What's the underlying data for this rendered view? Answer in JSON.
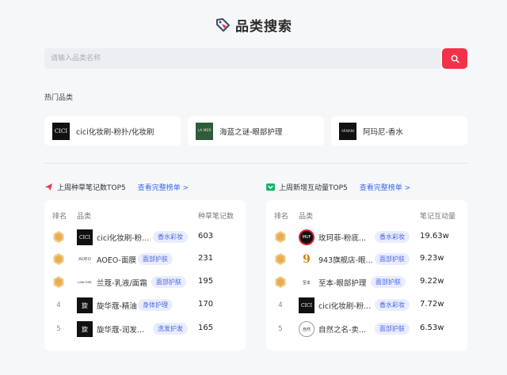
{
  "header": {
    "title": "品类搜索",
    "icon": "price-tag-icon"
  },
  "search": {
    "placeholder": "请输入品类名称",
    "button_icon": "search-icon"
  },
  "hot": {
    "label": "热门品类",
    "items": [
      {
        "name": "cici化妆刷-粉扑/化妆刷",
        "logo": "CICI"
      },
      {
        "name": "海蓝之谜-眼部护理",
        "logo": "LA MER"
      },
      {
        "name": "阿玛尼-香水",
        "logo": "ARMANI"
      }
    ]
  },
  "left": {
    "title": "上周种草笔记数TOP5",
    "link": "查看完整榜单 >",
    "col_rank": "排名",
    "col_category": "品类",
    "col_value": "种草笔记数",
    "rows": [
      {
        "rank": "1",
        "name": "cici化妆刷-粉...",
        "tag": "香水彩妆",
        "value": "603",
        "logo": "CICI"
      },
      {
        "rank": "2",
        "name": "AOEO-面膜",
        "tag": "面部护肤",
        "value": "231",
        "logo": "AOEO"
      },
      {
        "rank": "3",
        "name": "兰蔻-乳液/面霜",
        "tag": "面部护肤",
        "value": "195",
        "logo": "LANCOME"
      },
      {
        "rank": "4",
        "name": "旋华蔻-精油",
        "tag": "身体护理",
        "value": "170",
        "logo": "旋"
      },
      {
        "rank": "5",
        "name": "旋华蔻-润发...",
        "tag": "洗发护发",
        "value": "165",
        "logo": "旋"
      }
    ]
  },
  "right": {
    "title": "上周新增互动量TOP5",
    "link": "查看完整榜单 >",
    "col_rank": "排名",
    "col_category": "品类",
    "col_value": "笔记互动量",
    "rows": [
      {
        "rank": "1",
        "name": "玫珂菲-粉底...",
        "tag": "香水彩妆",
        "value": "19.63w",
        "logo": "MUF"
      },
      {
        "rank": "2",
        "name": "943旗舰店-眼...",
        "tag": "面部护肤",
        "value": "9.23w",
        "logo": "9"
      },
      {
        "rank": "3",
        "name": "至本-眼部护理",
        "tag": "面部护肤",
        "value": "9.22w",
        "logo": "至本"
      },
      {
        "rank": "4",
        "name": "cici化妆刷-粉...",
        "tag": "香水彩妆",
        "value": "7.72w",
        "logo": "CICI"
      },
      {
        "rank": "5",
        "name": "自然之名-卖...",
        "tag": "面部护肤",
        "value": "6.53w",
        "logo": "自然"
      }
    ]
  },
  "colors": {
    "accent": "#f0334a",
    "link": "#3c6df0",
    "badge_bg": "#e9edfd",
    "badge_text": "#4a67e6",
    "medal": "#e8b45c"
  }
}
